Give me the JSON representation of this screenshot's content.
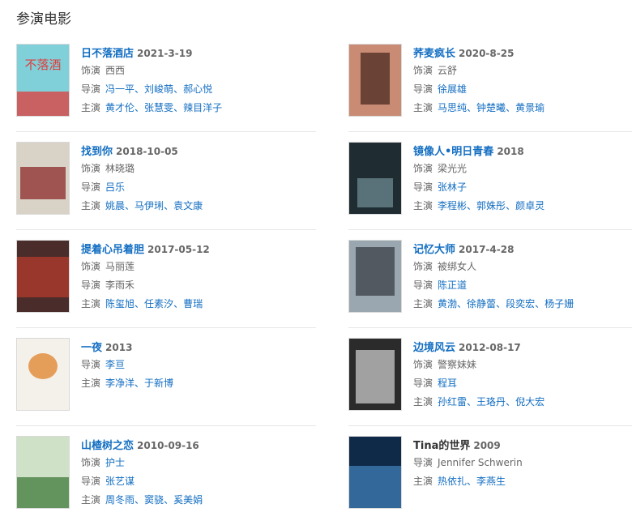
{
  "section": {
    "title": "参演电影"
  },
  "films": [
    {
      "title": "日不落酒店",
      "date": "2021-3-19",
      "rows": [
        {
          "label": "饰演",
          "values": [
            "西西"
          ],
          "linked": false
        },
        {
          "label": "导演",
          "values": [
            "冯一平",
            "刘峻萌",
            "郝心悦"
          ],
          "linked": true
        },
        {
          "label": "主演",
          "values": [
            "黄才伦",
            "张慧雯",
            "辣目洋子"
          ],
          "linked": true
        }
      ],
      "poster": {
        "bg": "#7fd0d8",
        "accent": "#e23b3b",
        "text": "不落酒"
      }
    },
    {
      "title": "荞麦疯长",
      "date": "2020-8-25",
      "rows": [
        {
          "label": "饰演",
          "values": [
            "云舒"
          ],
          "linked": false
        },
        {
          "label": "导演",
          "values": [
            "徐展雄"
          ],
          "linked": true
        },
        {
          "label": "主演",
          "values": [
            "马思纯",
            "钟楚曦",
            "黄景瑜"
          ],
          "linked": true
        }
      ],
      "poster": {
        "bg": "#c98b73",
        "accent": "#4a2a22",
        "text": ""
      }
    },
    {
      "title": "找到你",
      "date": "2018-10-05",
      "rows": [
        {
          "label": "饰演",
          "values": [
            "林晓璐"
          ],
          "linked": false
        },
        {
          "label": "导演",
          "values": [
            "吕乐"
          ],
          "linked": true
        },
        {
          "label": "主演",
          "values": [
            "姚晨",
            "马伊琍",
            "袁文康"
          ],
          "linked": true
        }
      ],
      "poster": {
        "bg": "#d9d2c6",
        "accent": "#8c2a2a",
        "text": ""
      }
    },
    {
      "title": "镜像人•明日青春",
      "date": "2018",
      "rows": [
        {
          "label": "饰演",
          "values": [
            "梁光光"
          ],
          "linked": false
        },
        {
          "label": "导演",
          "values": [
            "张林子"
          ],
          "linked": true
        },
        {
          "label": "主演",
          "values": [
            "李程彬",
            "郭姝彤",
            "颜卓灵"
          ],
          "linked": true
        }
      ],
      "poster": {
        "bg": "#1f2d33",
        "accent": "#6d8a93",
        "text": ""
      }
    },
    {
      "title": "提着心吊着胆",
      "date": "2017-05-12",
      "rows": [
        {
          "label": "饰演",
          "values": [
            "马丽莲"
          ],
          "linked": false
        },
        {
          "label": "导演",
          "values": [
            "李雨禾"
          ],
          "linked": false
        },
        {
          "label": "主演",
          "values": [
            "陈玺旭",
            "任素汐",
            "曹瑞"
          ],
          "linked": true
        }
      ],
      "poster": {
        "bg": "#4a2c2a",
        "accent": "#b63b2f",
        "text": ""
      }
    },
    {
      "title": "记忆大师",
      "date": "2017-4-28",
      "rows": [
        {
          "label": "饰演",
          "values": [
            "被绑女人"
          ],
          "linked": false
        },
        {
          "label": "导演",
          "values": [
            "陈正道"
          ],
          "linked": true
        },
        {
          "label": "主演",
          "values": [
            "黄渤",
            "徐静蕾",
            "段奕宏",
            "杨子姗"
          ],
          "linked": true
        }
      ],
      "poster": {
        "bg": "#9aa7b0",
        "accent": "#3b3f45",
        "text": ""
      }
    },
    {
      "title": "一夜",
      "date": "2013",
      "rows": [
        {
          "label": "导演",
          "values": [
            "李亘"
          ],
          "linked": true
        },
        {
          "label": "主演",
          "values": [
            "李净洋",
            "于新博"
          ],
          "linked": true
        }
      ],
      "poster": {
        "bg": "#f4f1ea",
        "accent": "#e0822a",
        "text": ""
      }
    },
    {
      "title": "边境风云",
      "date": "2012-08-17",
      "rows": [
        {
          "label": "饰演",
          "values": [
            "警察妹妹"
          ],
          "linked": false
        },
        {
          "label": "导演",
          "values": [
            "程耳"
          ],
          "linked": true
        },
        {
          "label": "主演",
          "values": [
            "孙红雷",
            "王珞丹",
            "倪大宏"
          ],
          "linked": true
        }
      ],
      "poster": {
        "bg": "#2b2b2b",
        "accent": "#c9c9c9",
        "text": ""
      }
    },
    {
      "title": "山楂树之恋",
      "date": "2010-09-16",
      "rows": [
        {
          "label": "饰演",
          "values": [
            "护士"
          ],
          "linked": true
        },
        {
          "label": "导演",
          "values": [
            "张艺谋"
          ],
          "linked": true
        },
        {
          "label": "主演",
          "values": [
            "周冬雨",
            "窦骁",
            "奚美娟"
          ],
          "linked": true
        }
      ],
      "poster": {
        "bg": "#cfe2c8",
        "accent": "#3f7a3a",
        "text": ""
      }
    },
    {
      "title": "Tina的世界",
      "date": "2009",
      "title_plain": true,
      "rows": [
        {
          "label": "导演",
          "values": [
            "Jennifer Schwerin"
          ],
          "linked": false
        },
        {
          "label": "主演",
          "values": [
            "热依扎",
            "李燕生"
          ],
          "linked": true
        }
      ],
      "poster": {
        "bg": "#0e2a48",
        "accent": "#3f7fb6",
        "text": ""
      }
    }
  ]
}
